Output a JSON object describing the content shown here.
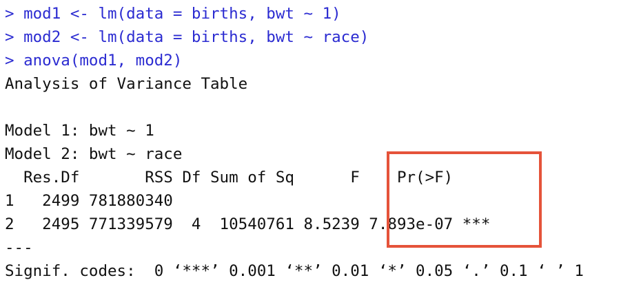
{
  "console": {
    "commands": [
      "> mod1 <- lm(data = births, bwt ~ 1)",
      "> mod2 <- lm(data = births, bwt ~ race)",
      "> anova(mod1, mod2)"
    ],
    "output": [
      "Analysis of Variance Table",
      "",
      "Model 1: bwt ~ 1",
      "Model 2: bwt ~ race",
      "  Res.Df       RSS Df Sum of Sq      F    Pr(>F)    ",
      "1   2499 781880340                                  ",
      "2   2495 771339579  4  10540761 8.5239 7.893e-07 ***",
      "---",
      "Signif. codes:  0 ‘***’ 0.001 ‘**’ 0.01 ‘*’ 0.05 ‘.’ 0.1 ‘ ’ 1"
    ]
  },
  "colors": {
    "command_text": "#2b2bd1",
    "output_text": "#111111",
    "highlight_border": "#e5533a"
  }
}
